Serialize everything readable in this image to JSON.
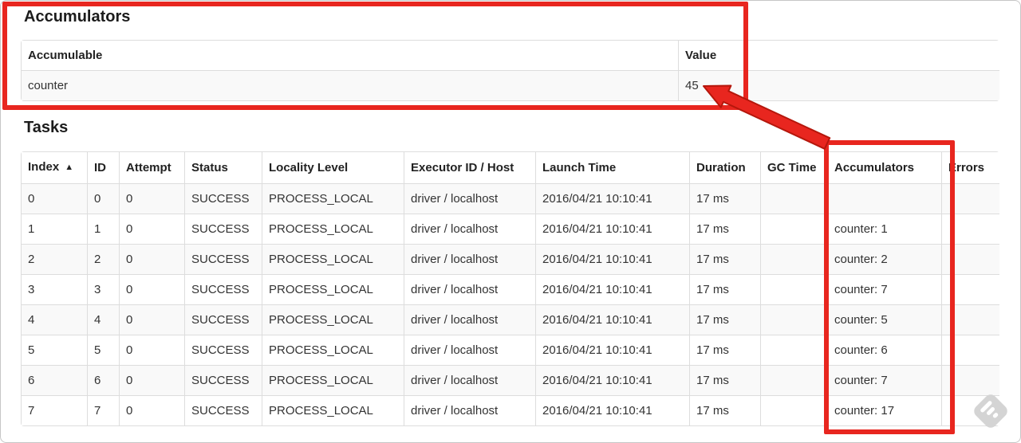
{
  "accumulators_section": {
    "title": "Accumulators",
    "table": {
      "columns": [
        "Accumulable",
        "Value"
      ],
      "rows": [
        [
          "counter",
          "45"
        ]
      ]
    }
  },
  "tasks_section": {
    "title": "Tasks",
    "table": {
      "columns": [
        "Index",
        "ID",
        "Attempt",
        "Status",
        "Locality Level",
        "Executor ID / Host",
        "Launch Time",
        "Duration",
        "GC Time",
        "Accumulators",
        "Errors"
      ],
      "sort": {
        "column": "Index",
        "direction": "ascending",
        "icon": "▲"
      },
      "rows": [
        [
          "0",
          "0",
          "0",
          "SUCCESS",
          "PROCESS_LOCAL",
          "driver / localhost",
          "2016/04/21 10:10:41",
          "17 ms",
          "",
          "",
          ""
        ],
        [
          "1",
          "1",
          "0",
          "SUCCESS",
          "PROCESS_LOCAL",
          "driver / localhost",
          "2016/04/21 10:10:41",
          "17 ms",
          "",
          "counter: 1",
          ""
        ],
        [
          "2",
          "2",
          "0",
          "SUCCESS",
          "PROCESS_LOCAL",
          "driver / localhost",
          "2016/04/21 10:10:41",
          "17 ms",
          "",
          "counter: 2",
          ""
        ],
        [
          "3",
          "3",
          "0",
          "SUCCESS",
          "PROCESS_LOCAL",
          "driver / localhost",
          "2016/04/21 10:10:41",
          "17 ms",
          "",
          "counter: 7",
          ""
        ],
        [
          "4",
          "4",
          "0",
          "SUCCESS",
          "PROCESS_LOCAL",
          "driver / localhost",
          "2016/04/21 10:10:41",
          "17 ms",
          "",
          "counter: 5",
          ""
        ],
        [
          "5",
          "5",
          "0",
          "SUCCESS",
          "PROCESS_LOCAL",
          "driver / localhost",
          "2016/04/21 10:10:41",
          "17 ms",
          "",
          "counter: 6",
          ""
        ],
        [
          "6",
          "6",
          "0",
          "SUCCESS",
          "PROCESS_LOCAL",
          "driver / localhost",
          "2016/04/21 10:10:41",
          "17 ms",
          "",
          "counter: 7",
          ""
        ],
        [
          "7",
          "7",
          "0",
          "SUCCESS",
          "PROCESS_LOCAL",
          "driver / localhost",
          "2016/04/21 10:10:41",
          "17 ms",
          "",
          "counter: 17",
          ""
        ]
      ]
    }
  },
  "annotations": {
    "highlight_color": "#e8261f",
    "watermark_color": "#d4d4d4"
  }
}
